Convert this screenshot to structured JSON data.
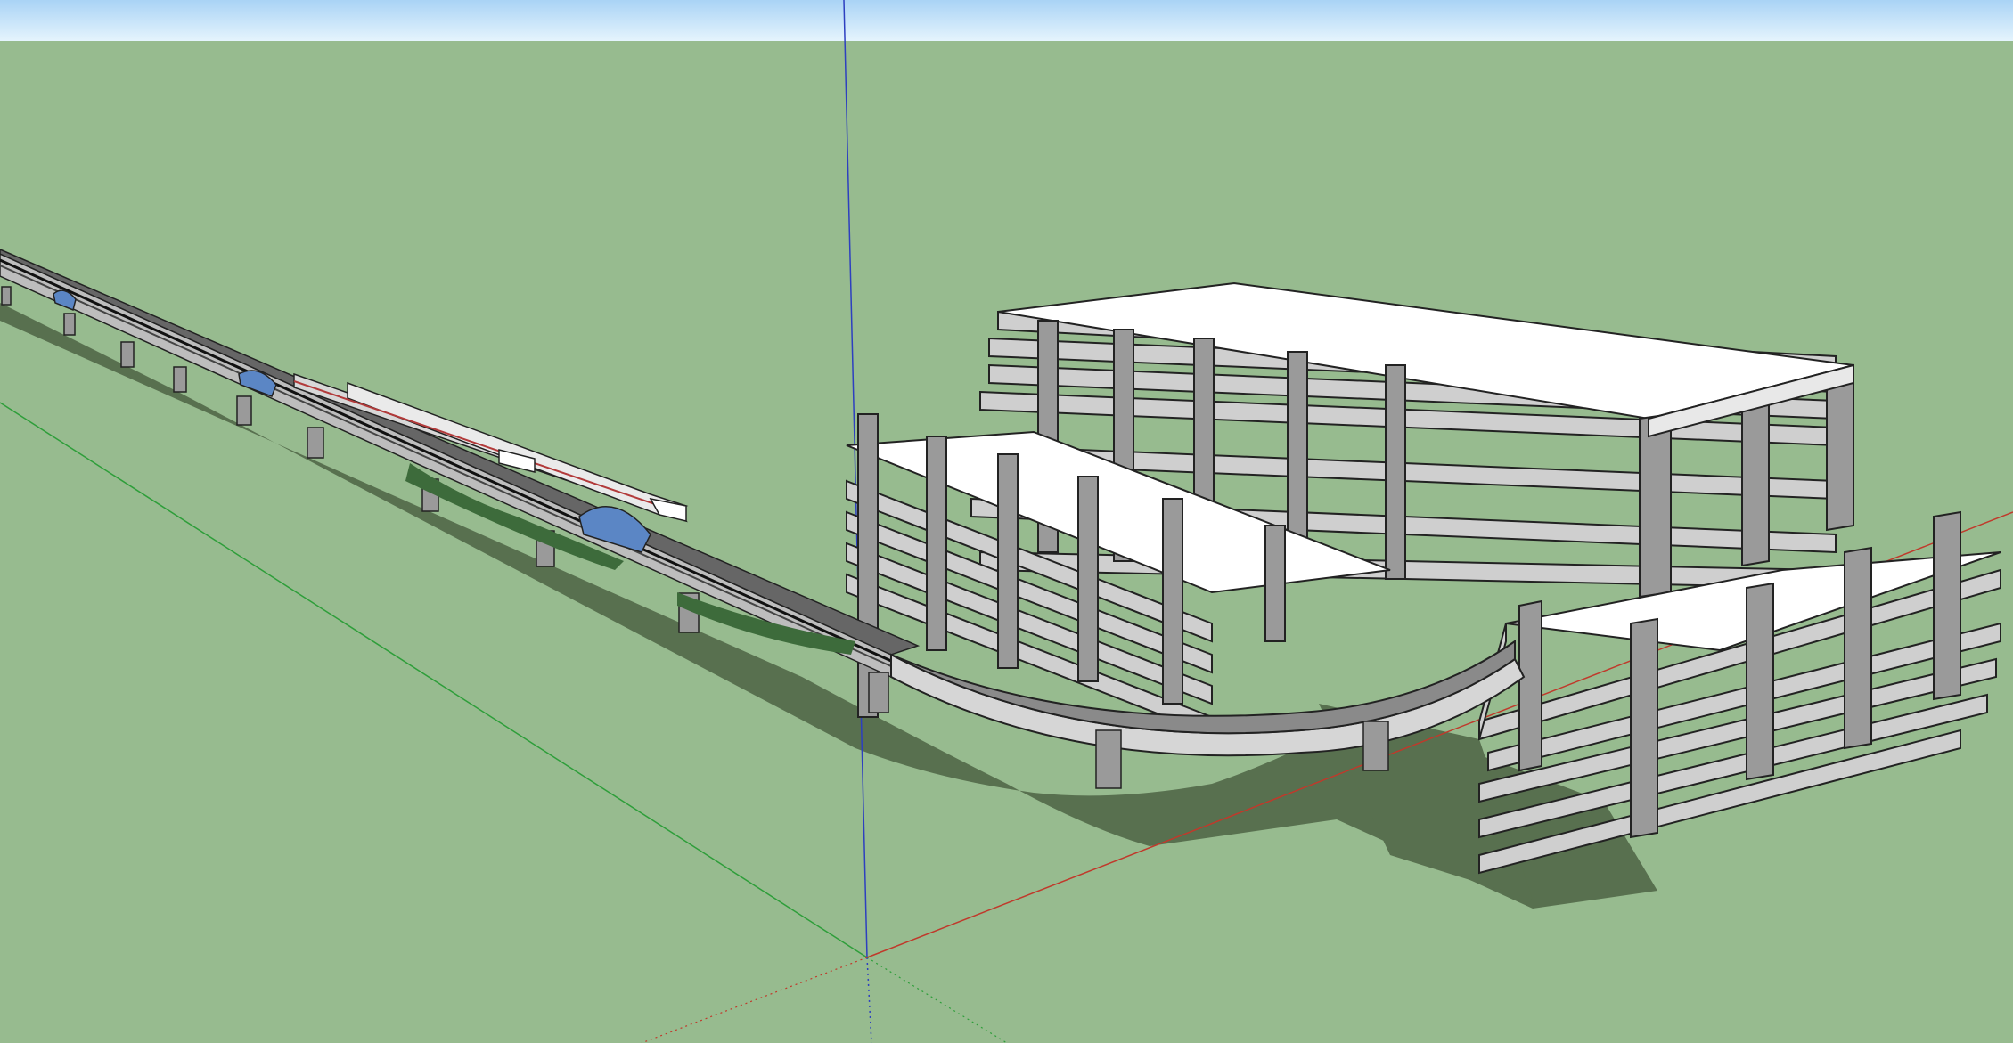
{
  "app": {
    "window_title": ""
  },
  "viewport": {
    "sky_colors": [
      "#a9d3f5",
      "#e5f4fd"
    ],
    "ground_color": "#97bb8f",
    "shadow_color": "#58704f",
    "axis_colors": {
      "red": "#c0392b",
      "green": "#2e9e3a",
      "blue": "#2d3fc0"
    },
    "model": {
      "elements": [
        "elevated-railway-viaduct",
        "high-speed-train",
        "covered-station-canopy",
        "curved-viaduct-ramp",
        "multi-storey-concrete-frame-building",
        "low-rise-parking-structure",
        "vegetation-strips",
        "viaduct-piers"
      ],
      "building_floor_count_tall": 7,
      "building_floor_count_low": 6,
      "canopy_color": "#5b86c5",
      "slab_color": "#ffffff",
      "column_color": "#9a9a9a",
      "train_stripe_color": "#b23a3a"
    }
  }
}
